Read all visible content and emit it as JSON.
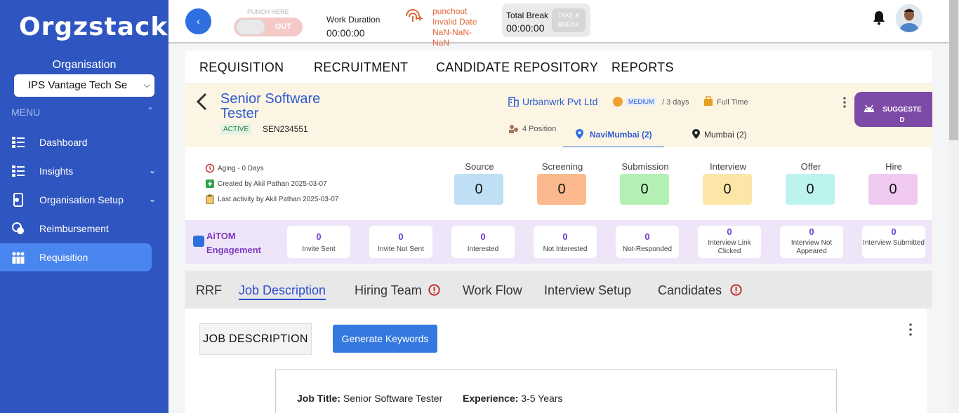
{
  "brand": {
    "logo_text": "Orgzstack"
  },
  "sidebar": {
    "org_label": "Organisation",
    "org_selected": "IPS Vantage Tech Se",
    "menu_label": "MENU",
    "items": [
      {
        "label": "Dashboard",
        "icon": "dashboard-icon"
      },
      {
        "label": "Insights",
        "icon": "insights-icon"
      },
      {
        "label": "Organisation Setup",
        "icon": "organisation-setup-icon"
      },
      {
        "label": "Reimbursement",
        "icon": "reimbursement-icon"
      },
      {
        "label": "Requisition",
        "icon": "requisition-icon",
        "active": true
      }
    ]
  },
  "topbar": {
    "punch_here": "PUNCH HERE",
    "punch_state": "OUT",
    "work_duration_label": "Work Duration",
    "work_duration_value": "00:00:00",
    "punchout_label": "punchout",
    "punchout_line2": "Invalid Date",
    "punchout_line3": "NaN-NaN-",
    "punchout_line4": "NaN",
    "total_break_label": "Total Break",
    "total_break_value": "00:00:00",
    "take_break_line1": "TAKE A",
    "take_break_line2": "BREAK"
  },
  "mainnav": [
    "REQUISITION",
    "RECRUITMENT",
    "CANDIDATE REPOSITORY",
    "REPORTS"
  ],
  "job": {
    "title": "Senior Software Tester",
    "status": "ACTIVE",
    "code": "SEN234551",
    "company": "Urbanwrk Pvt Ltd",
    "priority": "MEDIUM",
    "days": "/ 3 days",
    "employment_type": "Full Time",
    "positions": "4 Position",
    "locations": [
      "NaviMumbai (2)",
      "Mumbai (2)"
    ],
    "suggest_line1": "SUGGESTE",
    "suggest_line2": "D"
  },
  "meta": {
    "aging": "Aging - 0 Days",
    "created": "Created by Akil Pathan 2025-03-07",
    "last_activity": "Last activity by Akil Pathan 2025-03-07"
  },
  "stages": [
    {
      "label": "Source",
      "value": "0",
      "color": "#bfe0f4"
    },
    {
      "label": "Screening",
      "value": "0",
      "color": "#fbb98d"
    },
    {
      "label": "Submission",
      "value": "0",
      "color": "#b4f0b4"
    },
    {
      "label": "Interview",
      "value": "0",
      "color": "#fbe6a8"
    },
    {
      "label": "Offer",
      "value": "0",
      "color": "#bdf3ee"
    },
    {
      "label": "Hire",
      "value": "0",
      "color": "#efc9f0"
    }
  ],
  "engagement": {
    "title_line1": "AiTOM",
    "title_line2": "Engagement",
    "cards": [
      {
        "value": "0",
        "label": "Invite Sent"
      },
      {
        "value": "0",
        "label": "Invite Not Sent"
      },
      {
        "value": "0",
        "label": "Interested"
      },
      {
        "value": "0",
        "label": "Not Interested"
      },
      {
        "value": "0",
        "label": "Not-Responded"
      },
      {
        "value": "0",
        "label": "Interview Link Clicked"
      },
      {
        "value": "0",
        "label": "Interview Not Appeared"
      },
      {
        "value": "0",
        "label": "Interview Submitted"
      }
    ]
  },
  "subtabs": [
    "RRF",
    "Job Description",
    "Hiring Team",
    "Work Flow",
    "Interview Setup",
    "Candidates"
  ],
  "content": {
    "jd_button": "JOB DESCRIPTION",
    "generate_button": "Generate Keywords",
    "job_title_label": "Job Title:",
    "job_title_value": "Senior Software Tester",
    "experience_label": "Experience:",
    "experience_value": "3-5 Years"
  }
}
